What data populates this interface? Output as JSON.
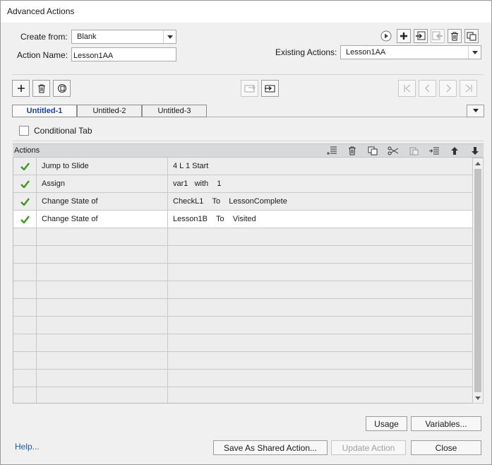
{
  "window": {
    "title": "Advanced Actions"
  },
  "form": {
    "create_from_label": "Create from:",
    "create_from_value": "Blank",
    "action_name_label": "Action Name:",
    "action_name_value": "Lesson1AA",
    "existing_actions_label": "Existing Actions:",
    "existing_actions_value": "Lesson1AA"
  },
  "tabs": [
    {
      "label": "Untitled-1",
      "active": true
    },
    {
      "label": "Untitled-2",
      "active": false
    },
    {
      "label": "Untitled-3",
      "active": false
    }
  ],
  "conditional_tab": {
    "label": "Conditional Tab",
    "checked": false
  },
  "actions_table": {
    "header": "Actions",
    "rows": [
      {
        "enabled": true,
        "action": "Jump to Slide",
        "detail": "4 L 1 Start"
      },
      {
        "enabled": true,
        "action": "Assign",
        "detail": "var1   with    1"
      },
      {
        "enabled": true,
        "action": "Change State of",
        "detail": "CheckL1    To    LessonComplete"
      },
      {
        "enabled": true,
        "action": "Change State of",
        "detail": "Lesson1B    To    Visited",
        "selected": true
      }
    ],
    "empty_rows": 10
  },
  "buttons": {
    "usage": "Usage",
    "variables": "Variables...",
    "save_shared": "Save As Shared Action...",
    "update": "Update Action",
    "close": "Close",
    "help": "Help..."
  },
  "colors": {
    "accent_tab": "#1c3fae",
    "check": "#3a9a1c",
    "link": "#1f5aa8"
  }
}
